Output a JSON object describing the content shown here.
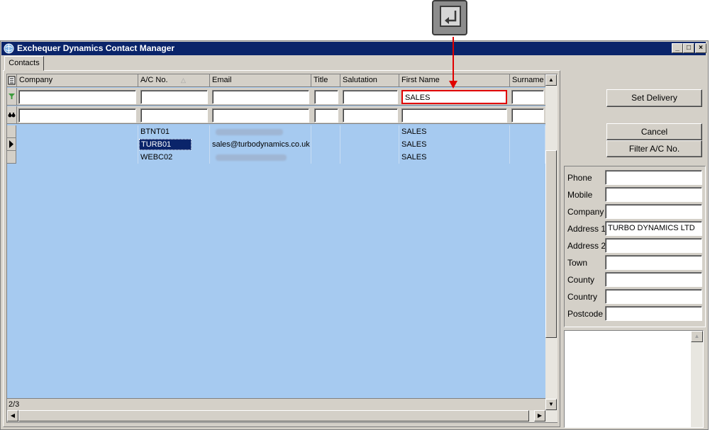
{
  "window": {
    "title": "Exchequer Dynamics Contact Manager",
    "controls": [
      "_",
      "□",
      "×"
    ]
  },
  "tabs": [
    {
      "label": "Contacts",
      "active": true
    }
  ],
  "grid": {
    "columns": [
      "Company",
      "A/C No.",
      "Email",
      "Title",
      "Salutation",
      "First Name",
      "Surname"
    ],
    "filter_row": [
      "",
      "",
      "",
      "",
      "",
      "SALES",
      ""
    ],
    "search_row": [
      "",
      "",
      "",
      "",
      "",
      "",
      ""
    ],
    "rows": [
      {
        "company": "",
        "ac_no": "BTNT01",
        "email": "",
        "title": "",
        "salutation": "",
        "first_name": "SALES",
        "surname": "",
        "selected": false,
        "email_blurred": true
      },
      {
        "company": "",
        "ac_no": "TURB01",
        "email": "sales@turbodynamics.co.uk",
        "title": "",
        "salutation": "",
        "first_name": "SALES",
        "surname": "",
        "selected": true,
        "email_blurred": false
      },
      {
        "company": "",
        "ac_no": "WEBC02",
        "email": "",
        "title": "",
        "salutation": "",
        "first_name": "SALES",
        "surname": "",
        "selected": false,
        "email_blurred": true
      }
    ],
    "status": "2/3",
    "sort_column": "A/C No."
  },
  "buttons": {
    "set_delivery": "Set Delivery",
    "cancel": "Cancel",
    "filter_ac": "Filter A/C No."
  },
  "details": {
    "fields": [
      {
        "label": "Phone",
        "value": ""
      },
      {
        "label": "Mobile",
        "value": ""
      },
      {
        "label": "Company",
        "value": ""
      },
      {
        "label": "Address 1",
        "value": "TURBO DYNAMICS LTD"
      },
      {
        "label": "Address 2",
        "value": ""
      },
      {
        "label": "Town",
        "value": ""
      },
      {
        "label": "County",
        "value": ""
      },
      {
        "label": "Country",
        "value": ""
      },
      {
        "label": "Postcode",
        "value": ""
      }
    ]
  },
  "colors": {
    "titlebar": "#0a246a",
    "grid_bg": "#a6caf0",
    "highlight_box": "#e00000",
    "arrow": "#e00000"
  },
  "callout": {
    "icon": "enter-key-icon"
  }
}
